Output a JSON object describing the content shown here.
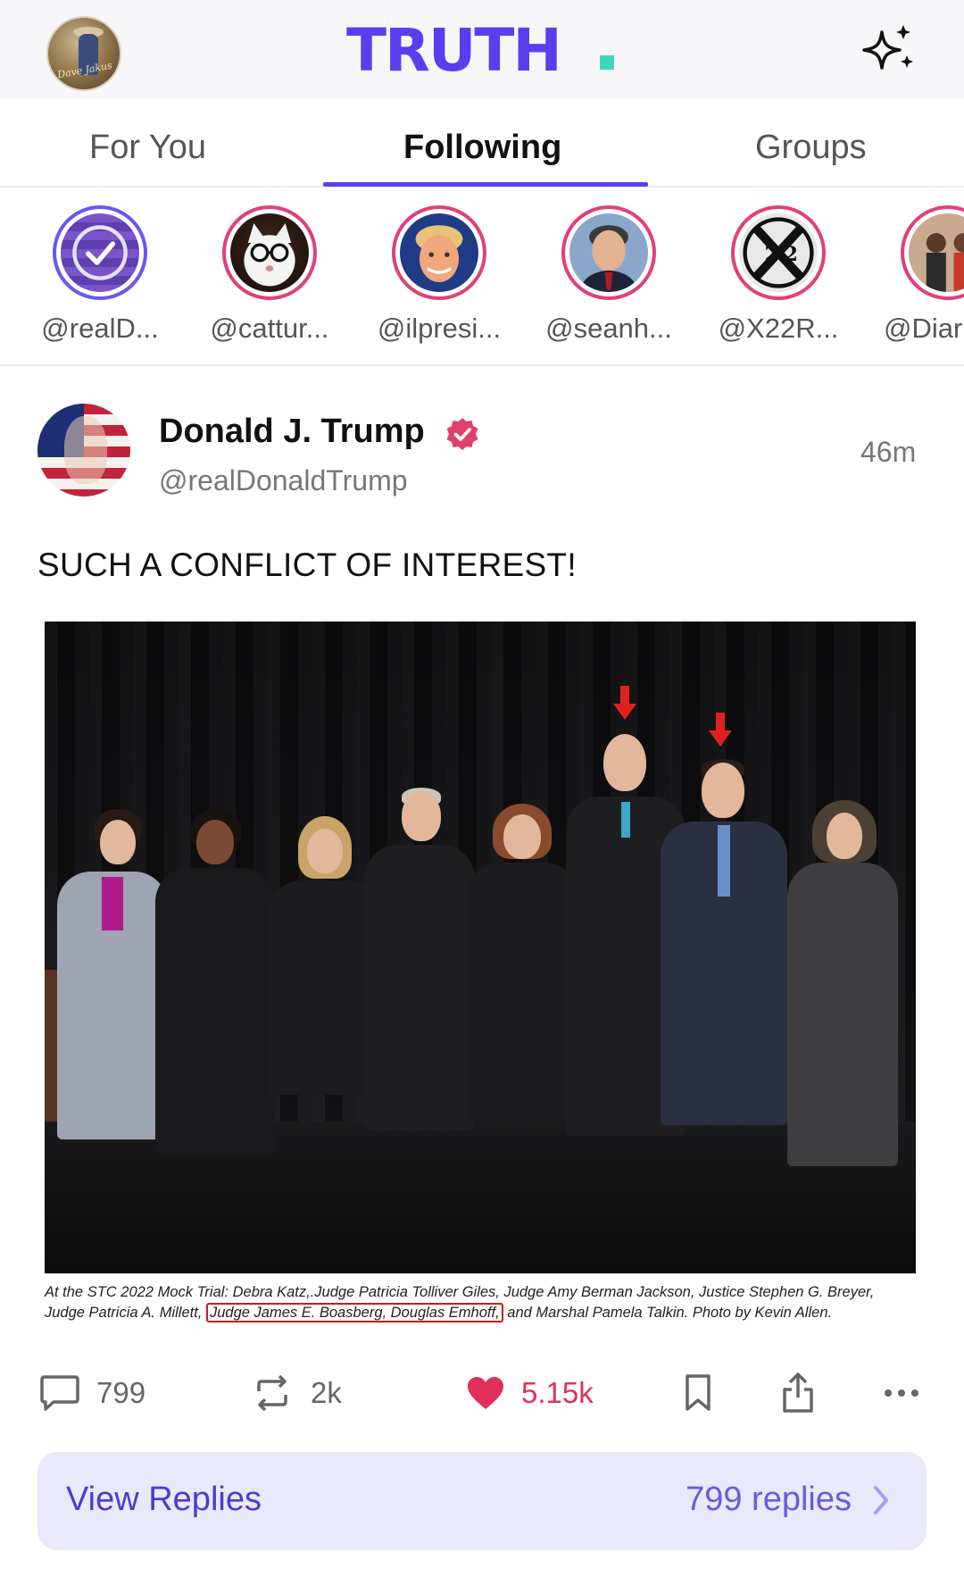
{
  "header": {
    "logo_text": "TRUTH",
    "avatar_signature": "Dave Jakus",
    "accent_color": "#5b3df0",
    "logo_dot_color": "#3ed6b8"
  },
  "tabs": [
    {
      "label": "For You",
      "active": false
    },
    {
      "label": "Following",
      "active": true
    },
    {
      "label": "Groups",
      "active": false
    }
  ],
  "stories": [
    {
      "handle": "@realD...",
      "icon": "verified-flag-avatar"
    },
    {
      "handle": "@cattur...",
      "icon": "cat-with-glasses-avatar"
    },
    {
      "handle": "@ilpresi...",
      "icon": "trump-avatar"
    },
    {
      "handle": "@seanh...",
      "icon": "hannity-avatar"
    },
    {
      "handle": "@X22R...",
      "icon": "x22-logo-avatar"
    },
    {
      "handle": "@Diar",
      "icon": "diamond-silk-avatar"
    }
  ],
  "post": {
    "author": "Donald J. Trump",
    "handle": "@realDonaldTrump",
    "time": "46m",
    "text": "SUCH A CONFLICT OF INTEREST!",
    "image_caption_line1": "At the STC 2022 Mock Trial: Debra Katz,.Judge Patricia Tolliver Giles, Judge Amy Berman Jackson, Justice Stephen G. Breyer,",
    "image_caption_line2_before": "Judge Patricia A. Millett,",
    "image_caption_line2_boxed": "Judge James E. Boasberg, Douglas Emhoff,",
    "image_caption_line2_after": "and Marshal Pamela Talkin. Photo by Kevin Allen.",
    "actions": {
      "replies": "799",
      "retruths": "2k",
      "likes": "5.15k"
    }
  },
  "replies_bar": {
    "label": "View Replies",
    "count": "799 replies"
  }
}
